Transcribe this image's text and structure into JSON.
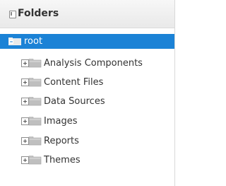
{
  "panel": {
    "title": "Folders",
    "title_icon": "panel-icon"
  },
  "tree": {
    "root": {
      "label": "root",
      "icon": "folder-open-icon",
      "selected": true
    },
    "items": [
      {
        "label": "Analysis Components",
        "icon": "expand-folder-icon"
      },
      {
        "label": "Content Files",
        "icon": "expand-folder-icon"
      },
      {
        "label": "Data Sources",
        "icon": "expand-folder-icon"
      },
      {
        "label": "Images",
        "icon": "expand-folder-icon"
      },
      {
        "label": "Reports",
        "icon": "expand-folder-icon"
      },
      {
        "label": "Themes",
        "icon": "expand-folder-icon"
      }
    ]
  },
  "colors": {
    "selection": "#1b82d6",
    "header_bg": "#efefef",
    "folder": "#c9c9c9"
  }
}
